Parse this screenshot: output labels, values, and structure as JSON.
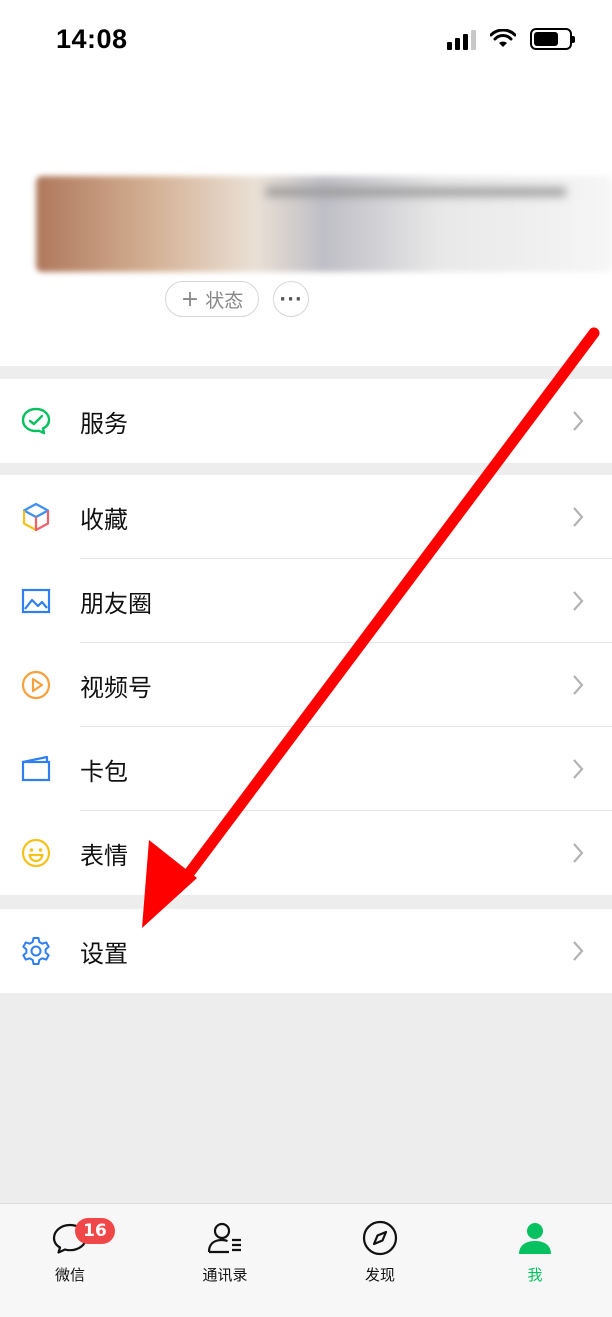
{
  "status_bar": {
    "time": "14:08"
  },
  "profile": {
    "status_button": "状态",
    "more_button": "···"
  },
  "menu": {
    "services": "服务",
    "favorites": "收藏",
    "moments": "朋友圈",
    "channels": "视频号",
    "cards": "卡包",
    "stickers": "表情",
    "settings": "设置"
  },
  "tabbar": {
    "chats": {
      "label": "微信",
      "badge": "16"
    },
    "contacts": {
      "label": "通讯录"
    },
    "discover": {
      "label": "发现"
    },
    "me": {
      "label": "我"
    }
  },
  "colors": {
    "accent": "#07c160",
    "badge": "#f04848",
    "arrow": "#ff0000"
  }
}
